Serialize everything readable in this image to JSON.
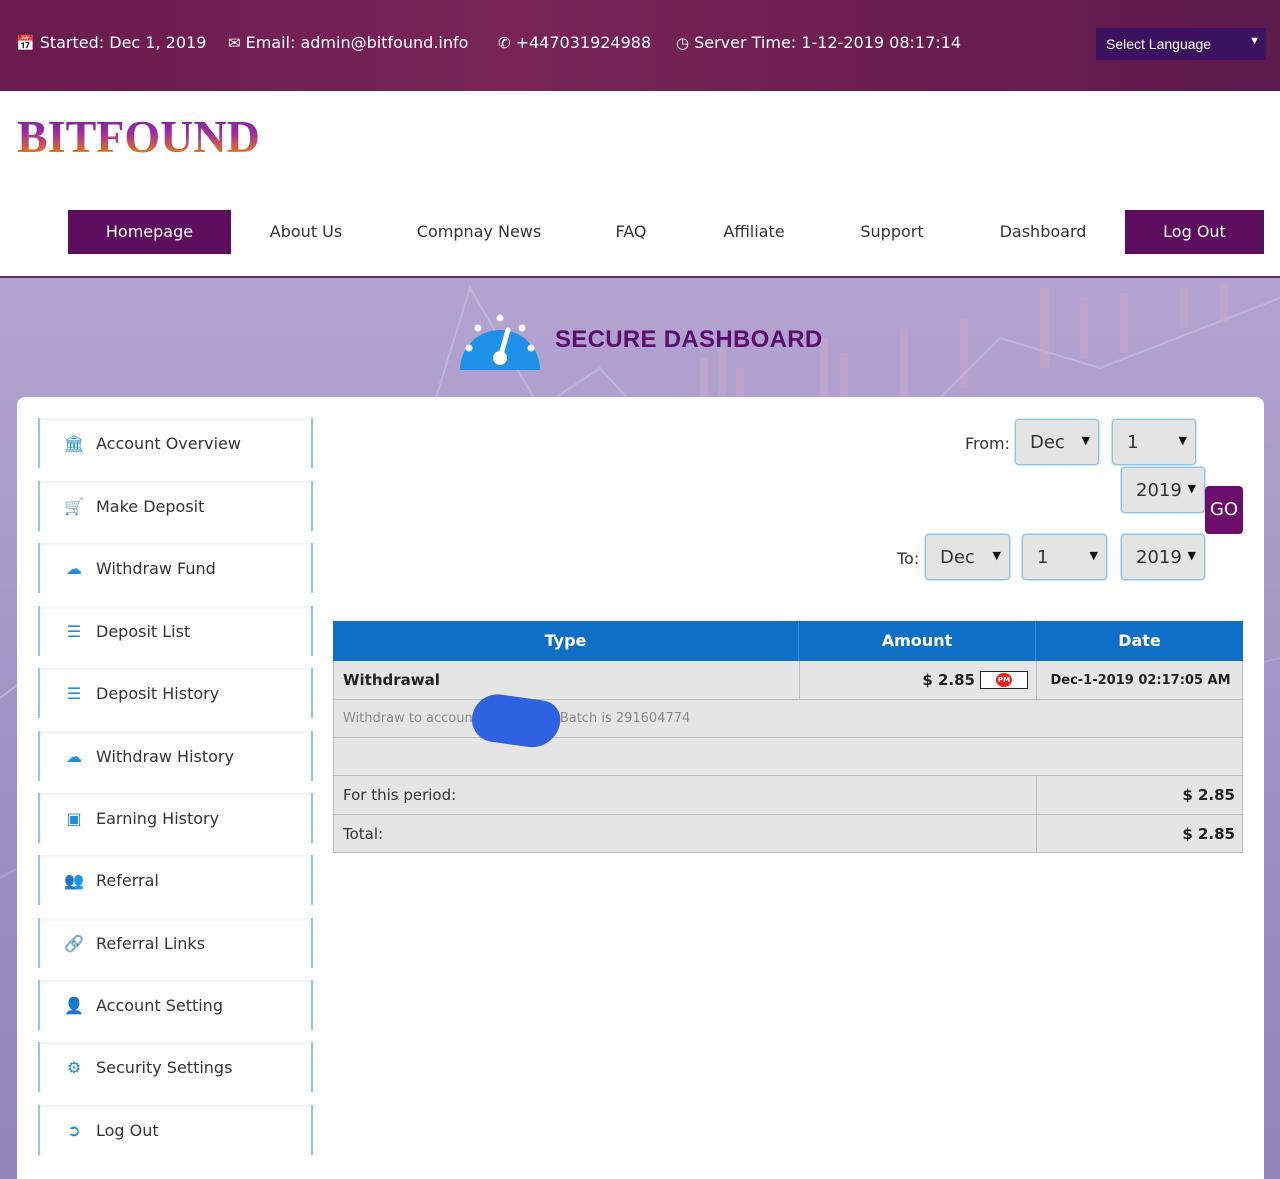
{
  "topbar": {
    "started": "Started: Dec 1, 2019",
    "email": "Email: admin@bitfound.info",
    "phone": "+447031924988",
    "server_time": "Server Time: 1-12-2019 08:17:14",
    "language_select": "Select Language"
  },
  "logo": {
    "text": "BITFOUND"
  },
  "nav": {
    "items": [
      {
        "label": "Homepage"
      },
      {
        "label": "About Us"
      },
      {
        "label": "Compnay News"
      },
      {
        "label": "FAQ"
      },
      {
        "label": "Affiliate"
      },
      {
        "label": "Support"
      },
      {
        "label": "Dashboard"
      },
      {
        "label": "Log Out"
      }
    ]
  },
  "hero": {
    "title": "SECURE DASHBOARD"
  },
  "sidebar": {
    "items": [
      {
        "label": "Account Overview",
        "icon": "bank-icon"
      },
      {
        "label": "Make Deposit",
        "icon": "cart-icon"
      },
      {
        "label": "Withdraw Fund",
        "icon": "cloud-upload-icon"
      },
      {
        "label": "Deposit List",
        "icon": "server-icon"
      },
      {
        "label": "Deposit History",
        "icon": "server-icon"
      },
      {
        "label": "Withdraw History",
        "icon": "cloud-upload-icon"
      },
      {
        "label": "Earning History",
        "icon": "credit-card-icon"
      },
      {
        "label": "Referral",
        "icon": "users-icon"
      },
      {
        "label": "Referral Links",
        "icon": "link-icon"
      },
      {
        "label": "Account Setting",
        "icon": "user-plus-icon"
      },
      {
        "label": "Security Settings",
        "icon": "cogs-icon"
      },
      {
        "label": "Log Out",
        "icon": "sign-out-icon"
      }
    ]
  },
  "filter": {
    "from_label": "From:",
    "from_month": "Dec",
    "from_day": "1",
    "from_year": "2019",
    "to_label": "To:",
    "to_month": "Dec",
    "to_day": "1",
    "to_year": "2019",
    "go_label": "GO"
  },
  "table": {
    "headers": {
      "type": "Type",
      "amount": "Amount",
      "date": "Date"
    },
    "rows": [
      {
        "type": "Withdrawal",
        "amount": "$ 2.85",
        "processor": "PM",
        "date": "Dec-1-2019 02:17:05 AM"
      }
    ],
    "description_left": "Withdraw to account",
    "description_right": "Batch is 291604774",
    "period_label": "For this period:",
    "period_value": "$ 2.85",
    "total_label": "Total:",
    "total_value": "$ 2.85"
  }
}
